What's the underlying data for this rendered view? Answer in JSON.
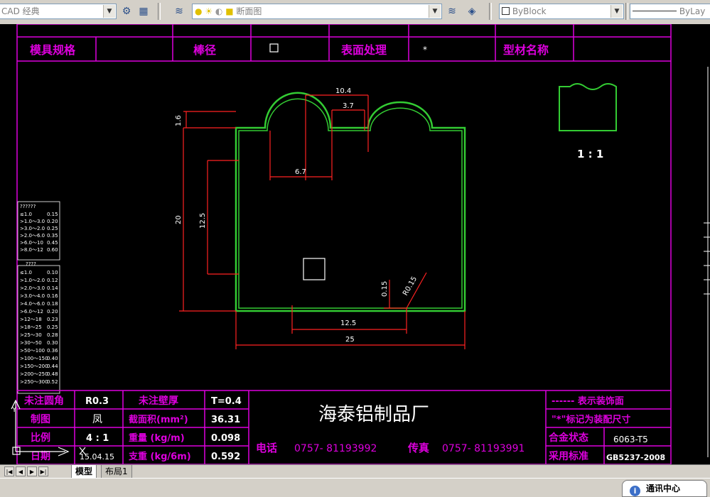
{
  "toolbar": {
    "workspace": "CAD 经典",
    "layer": "断面图",
    "color": "ByBlock",
    "linetype": "ByLay"
  },
  "title_block_top": {
    "mold_spec_label": "模具规格",
    "rod_diameter_label": "棒径",
    "surface_label": "表面处理",
    "surface_value": "*",
    "profile_name_label": "型材名称"
  },
  "dimensions": {
    "d10_4": "10.4",
    "d3_7": "3.7",
    "d1_6": "1.6",
    "d6_7": "6.7",
    "d20": "20",
    "d12_5v": "12.5",
    "d12_5h": "12.5",
    "d25": "25",
    "d0_15": "0.15",
    "r0_15": "R0.15"
  },
  "preview_scale": "1 : 1",
  "tolerance_table": {
    "header1": "??????",
    "rows1": [
      [
        "≤1.0",
        "0.15"
      ],
      [
        ">1.0～3.0",
        "0.20"
      ],
      [
        ">3.0～2.0",
        "0.25"
      ],
      [
        ">2.0～6.0",
        "0.35"
      ],
      [
        ">6.0～10",
        "0.45"
      ],
      [
        ">8.0～12",
        "0.60"
      ]
    ],
    "header2": "????",
    "rows2": [
      [
        "≤1.0",
        "0.10"
      ],
      [
        ">1.0～2.0",
        "0.12"
      ],
      [
        ">2.0～3.0",
        "0.14"
      ],
      [
        ">3.0～4.0",
        "0.16"
      ],
      [
        ">4.0～6.0",
        "0.18"
      ],
      [
        ">6.0～12",
        "0.20"
      ],
      [
        ">12～18",
        "0.23"
      ],
      [
        ">18～25",
        "0.25"
      ],
      [
        ">25～30",
        "0.28"
      ],
      [
        ">30～50",
        "0.30"
      ],
      [
        ">50～100",
        "0.36"
      ],
      [
        ">100～150",
        "0.40"
      ],
      [
        ">150～200",
        "0.44"
      ],
      [
        ">200～250",
        "0.48"
      ],
      [
        ">250～300",
        "0.52"
      ]
    ]
  },
  "title_block_bottom": {
    "fillet_label": "未注圆角",
    "fillet_value": "R0.3",
    "wall_label": "未注壁厚",
    "wall_value": "T=0.4",
    "drawn_label": "制图",
    "drawn_value": "凤",
    "area_label": "截面积(mm²)",
    "area_value": "36.31",
    "scale_label": "比例",
    "scale_value": "4 : 1",
    "weight_label": "重量 (kg/m)",
    "weight_value": "0.098",
    "date_label": "日期",
    "date_value": "15.04.15",
    "support_label": "支重 (kg/6m)",
    "support_value": "0.592",
    "company": "海泰铝制品厂",
    "phone_label": "电话",
    "phone": "0757- 81193992",
    "fax_label": "传真",
    "fax": "0757- 81193991",
    "legend1": "------ 表示装饰面",
    "legend2": "\"*\"标记为装配尺寸",
    "alloy_label": "合金状态",
    "alloy_value": "6063-T5",
    "standard_label": "采用标准",
    "standard_value": "GB5237-2008"
  },
  "tabs": [
    "模型",
    "布局1"
  ],
  "status": {
    "comm_center": "通讯中心"
  }
}
